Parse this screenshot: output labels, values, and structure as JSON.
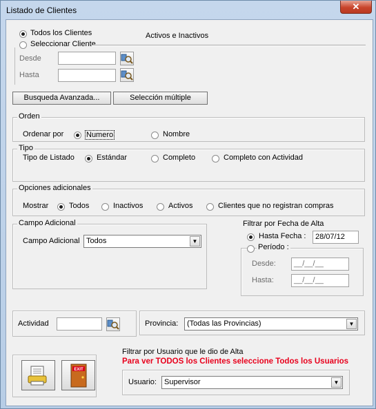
{
  "window": {
    "title": "Listado de Clientes",
    "close_glyph": "✕"
  },
  "client_select": {
    "all_label": "Todos los Clientes",
    "select_label": "Seleccionar Cliente",
    "activos_label": "Activos e Inactivos",
    "desde_label": "Desde",
    "hasta_label": "Hasta",
    "desde_value": "",
    "hasta_value": ""
  },
  "buttons": {
    "busqueda": "Busqueda Avanzada...",
    "seleccion": "Selección múltiple"
  },
  "orden": {
    "title": "Orden",
    "label": "Ordenar por",
    "numero": "Numero",
    "nombre": "Nombre"
  },
  "tipo": {
    "title": "Tipo",
    "label": "Tipo de Listado",
    "estandar": "Estándar",
    "completo": "Completo",
    "completo_act": "Completo con Actividad"
  },
  "opciones": {
    "title": "Opciones adicionales",
    "mostrar": "Mostrar",
    "todos": "Todos",
    "inactivos": "Inactivos",
    "activos": "Activos",
    "sin_compras": "Clientes que no registran compras"
  },
  "campo": {
    "title": "Campo Adicional",
    "label": "Campo Adicional",
    "value": "Todos"
  },
  "fecha": {
    "title": "Filtrar por Fecha de Alta",
    "hasta_label": "Hasta Fecha :",
    "hasta_value": "28/07/12",
    "periodo_label": "Período :",
    "desde_label": "Desde:",
    "hasta2_label": "Hasta:",
    "desde_value": "__/__/__",
    "hasta2_value": "__/__/__"
  },
  "actividad": {
    "label": "Actividad",
    "value": ""
  },
  "provincia": {
    "label": "Provincia:",
    "value": "(Todas las Provincias)"
  },
  "usuario": {
    "filter_label": "Filtrar por Usuario que le dio de Alta",
    "warning": "Para ver TODOS los Clientes seleccione Todos los Usuarios",
    "label": "Usuario:",
    "value": "Supervisor"
  },
  "colors": {
    "warning": "#e8001c"
  }
}
